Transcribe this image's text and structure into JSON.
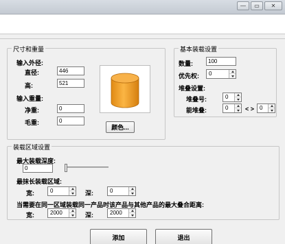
{
  "window": {
    "minimize_glyph": "—",
    "maximize_glyph": "▭",
    "close_glyph": "✕"
  },
  "size_weight": {
    "legend": "尺寸和重量",
    "outer_size_label": "输入外径:",
    "diameter_label": "直径:",
    "diameter_value": "446",
    "height_label": "高:",
    "height_value": "521",
    "weight_label": "输入重量:",
    "net_label": "净重:",
    "net_value": "0",
    "gross_label": "毛重:",
    "gross_value": "0",
    "color_button": "颜色...",
    "preview_icon": "cylinder-icon",
    "preview_color": "#f4a12a"
  },
  "basic": {
    "legend": "基本装载设置",
    "qty_label": "数量:",
    "qty_value": "100",
    "priority_label": "优先权:",
    "priority_value": "0",
    "stack_legend": "堆叠设置:",
    "stack_no_label": "堆叠号:",
    "stack_no_value": "0",
    "can_stack_label": "能堆叠:",
    "can_stack_value1": "0",
    "range_sep": "< >",
    "can_stack_value2": "0"
  },
  "area": {
    "legend": "装载区域设置",
    "max_depth_label": "最大装载深度:",
    "max_depth_value": "0",
    "min_length_label": "最抹长装载区域:",
    "width_label": "宽:",
    "width_value": "0",
    "depth_label": "深:",
    "depth_value": "0",
    "same_area_label": "当需要在同一区域装载同一产品时该产品与其他产品的最大叠合距离:",
    "width2_label": "宽:",
    "width2_value": "2000",
    "depth2_label": "深:",
    "depth2_value": "2000"
  },
  "footer": {
    "add_button": "添加",
    "exit_button": "退出"
  }
}
